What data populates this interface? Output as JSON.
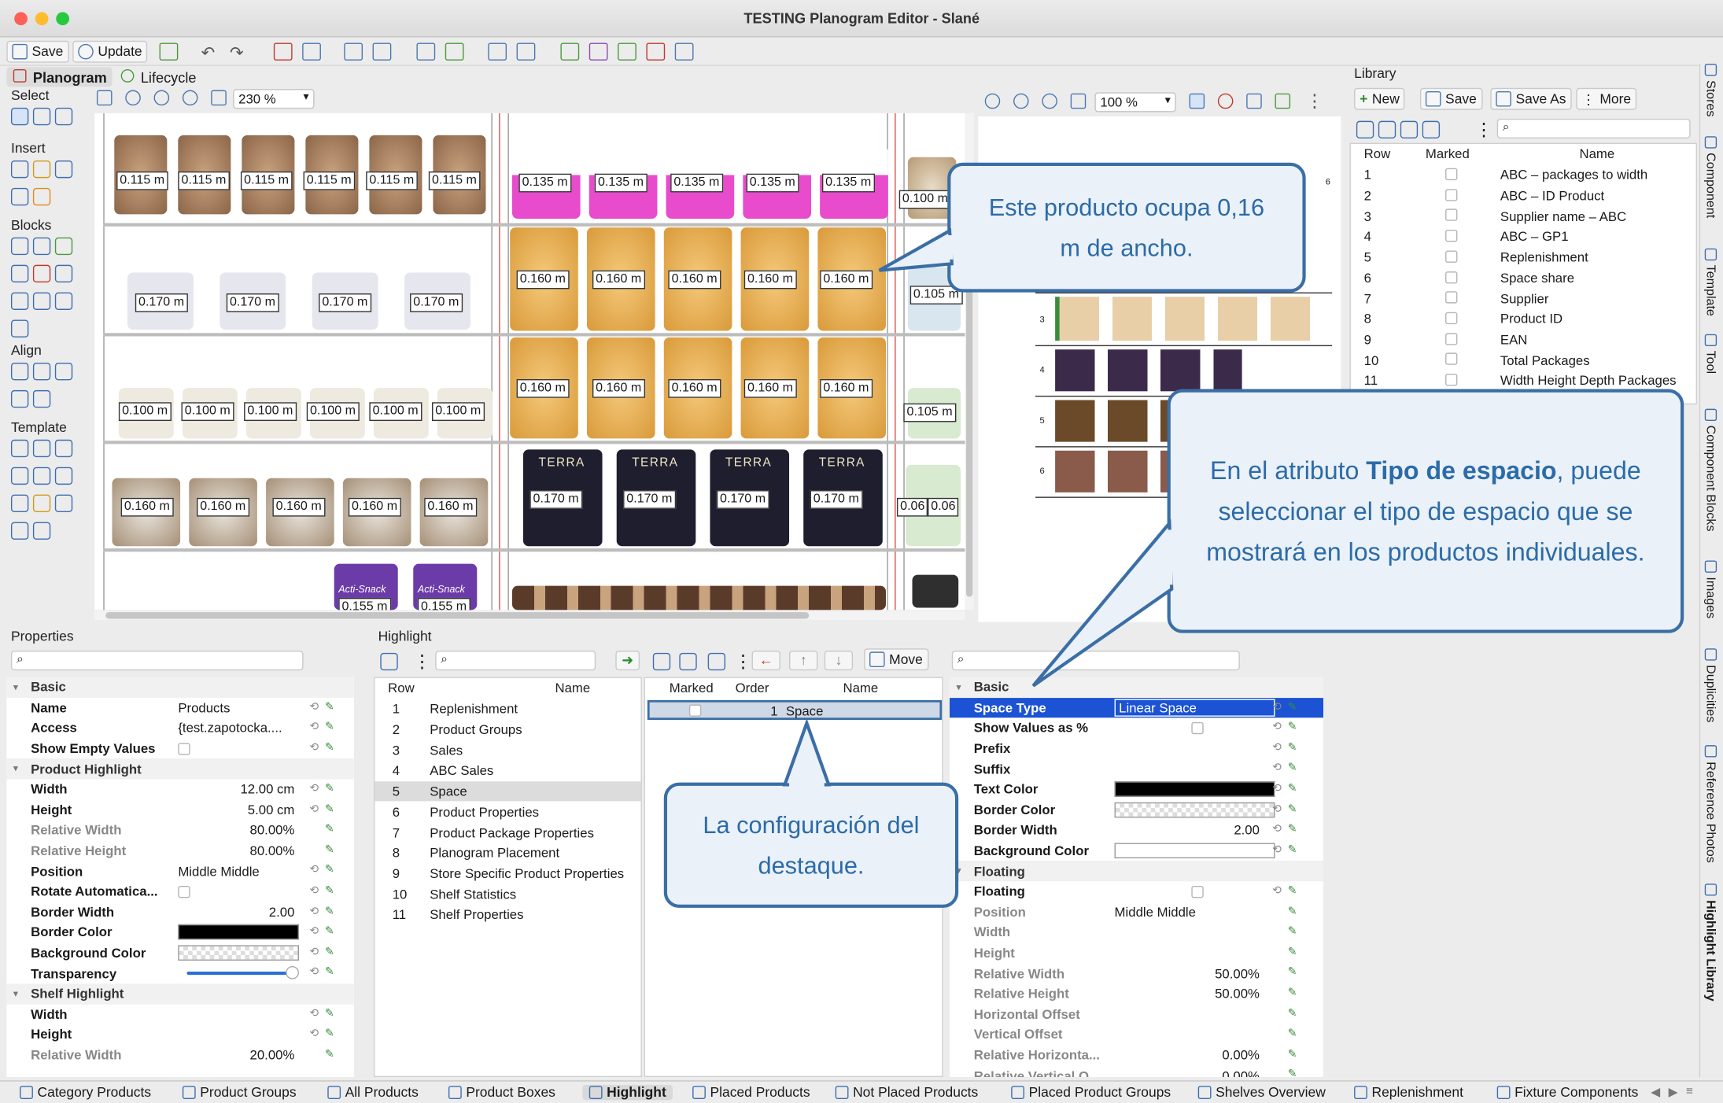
{
  "window": {
    "title": "TESTING Planogram Editor - Slané"
  },
  "toolbar": {
    "save": "Save",
    "update": "Update"
  },
  "tabs": {
    "planogram": "Planogram",
    "lifecycle": "Lifecycle"
  },
  "left_palette": {
    "select": "Select",
    "insert": "Insert",
    "blocks": "Blocks",
    "align": "Align",
    "template": "Template"
  },
  "planogram_view": {
    "zoom": "230 %"
  },
  "planogram_labels": {
    "row1a": "0.115 m",
    "row1b": "0.135 m",
    "row1c": "0.100 m",
    "row2a": "0.170 m",
    "row2b": "0.160 m",
    "row2c": "0.105 m",
    "row3a": "0.100 m",
    "row3b": "0.160 m",
    "row3c": "0.105 m",
    "row4a": "0.160 m",
    "row4b": "0.170 m",
    "row4c1": "0.06",
    "row4c2": "0.06",
    "row5b": "0.155 m",
    "terra": "TERRA",
    "acti": "Acti-Snack"
  },
  "mini_view": {
    "zoom": "100 %",
    "shelf_numbers": [
      "6",
      "3",
      "4",
      "5",
      "6"
    ]
  },
  "library": {
    "title": "Library",
    "buttons": {
      "new": "New",
      "save": "Save",
      "save_as": "Save As",
      "more": "More"
    },
    "columns": {
      "row": "Row",
      "marked": "Marked",
      "name": "Name"
    },
    "rows": [
      {
        "n": "1",
        "name": "ABC – packages to width"
      },
      {
        "n": "2",
        "name": "ABC – ID Product"
      },
      {
        "n": "3",
        "name": "Supplier name – ABC"
      },
      {
        "n": "4",
        "name": "ABC – GP1"
      },
      {
        "n": "5",
        "name": "Replenishment"
      },
      {
        "n": "6",
        "name": "Space share"
      },
      {
        "n": "7",
        "name": "Supplier"
      },
      {
        "n": "8",
        "name": "Product ID"
      },
      {
        "n": "9",
        "name": "EAN"
      },
      {
        "n": "10",
        "name": "Total Packages"
      },
      {
        "n": "11",
        "name": "Width Height Depth Packages"
      }
    ]
  },
  "side_tabs": [
    "Stores",
    "Component",
    "Template",
    "Tool",
    "Component Blocks",
    "Images",
    "Duplicities",
    "Reference Photos",
    "Highlight Library"
  ],
  "properties": {
    "title": "Properties",
    "basic": "Basic",
    "rows": [
      {
        "name": "Name",
        "value": "Products"
      },
      {
        "name": "Access",
        "value": "{test.zapotocka...."
      },
      {
        "name": "Show Empty Values",
        "value": ""
      }
    ],
    "product_highlight": "Product Highlight",
    "ph_rows": [
      {
        "name": "Width",
        "value": "12.00 cm"
      },
      {
        "name": "Height",
        "value": "5.00 cm"
      },
      {
        "name": "Relative Width",
        "value": "80.00%"
      },
      {
        "name": "Relative Height",
        "value": "80.00%"
      },
      {
        "name": "Position",
        "value": "Middle Middle"
      },
      {
        "name": "Rotate Automatica...",
        "value": ""
      },
      {
        "name": "Border Width",
        "value": "2.00"
      },
      {
        "name": "Border Color",
        "value": ""
      },
      {
        "name": "Background Color",
        "value": ""
      },
      {
        "name": "Transparency",
        "value": ""
      }
    ],
    "shelf_highlight": "Shelf Highlight",
    "sh_rows": [
      {
        "name": "Width",
        "value": ""
      },
      {
        "name": "Height",
        "value": ""
      },
      {
        "name": "Relative Width",
        "value": "20.00%"
      }
    ]
  },
  "highlight": {
    "title": "Highlight",
    "columns": {
      "row": "Row",
      "name": "Name"
    },
    "rows": [
      {
        "n": "1",
        "name": "Replenishment"
      },
      {
        "n": "2",
        "name": "Product Groups"
      },
      {
        "n": "3",
        "name": "Sales"
      },
      {
        "n": "4",
        "name": "ABC Sales"
      },
      {
        "n": "5",
        "name": "Space"
      },
      {
        "n": "6",
        "name": "Product Properties"
      },
      {
        "n": "7",
        "name": "Product Package Properties"
      },
      {
        "n": "8",
        "name": "Planogram Placement"
      },
      {
        "n": "9",
        "name": "Store Specific Product Properties"
      },
      {
        "n": "10",
        "name": "Shelf Statistics"
      },
      {
        "n": "11",
        "name": "Shelf Properties"
      }
    ],
    "sub_columns": {
      "marked": "Marked",
      "order": "Order",
      "name": "Name"
    },
    "sub_row": {
      "order": "1",
      "name": "Space"
    },
    "move": "Move"
  },
  "space_props": {
    "basic": "Basic",
    "rows": [
      {
        "name": "Space Type",
        "value": "Linear Space"
      },
      {
        "name": "Show Values as %",
        "value": ""
      },
      {
        "name": "Prefix",
        "value": ""
      },
      {
        "name": "Suffix",
        "value": ""
      },
      {
        "name": "Text Color",
        "value": ""
      },
      {
        "name": "Border Color",
        "value": ""
      },
      {
        "name": "Border Width",
        "value": "2.00"
      },
      {
        "name": "Background Color",
        "value": ""
      }
    ],
    "floating": "Floating",
    "f_rows": [
      {
        "name": "Floating",
        "value": ""
      },
      {
        "name": "Position",
        "value": "Middle Middle"
      },
      {
        "name": "Width",
        "value": ""
      },
      {
        "name": "Height",
        "value": ""
      },
      {
        "name": "Relative Width",
        "value": "50.00%"
      },
      {
        "name": "Relative Height",
        "value": "50.00%"
      },
      {
        "name": "Horizontal Offset",
        "value": ""
      },
      {
        "name": "Vertical Offset",
        "value": ""
      },
      {
        "name": "Relative Horizonta...",
        "value": "0.00%"
      },
      {
        "name": "Relative Vertical O...",
        "value": "0.00%"
      }
    ]
  },
  "callouts": {
    "c1": "Este producto ocupa 0,16 m de ancho.",
    "c2_pre": "En el atributo ",
    "c2_bold": "Tipo de espacio",
    "c2_post": ", puede seleccionar el tipo de espacio que se mostrará en los productos individuales.",
    "c3": "La configuración del destaque."
  },
  "bottom_tabs": [
    "Category Products",
    "Product Groups",
    "All Products",
    "Product Boxes",
    "Highlight",
    "Placed Products",
    "Not Placed Products",
    "Placed Product Groups",
    "Shelves Overview",
    "Replenishment",
    "Fixture Components"
  ],
  "colors": {
    "accent": "#1a5fd0",
    "callout_border": "#3b6ea5",
    "callout_text": "#2c6ba8",
    "selection": "#1b53d4"
  }
}
